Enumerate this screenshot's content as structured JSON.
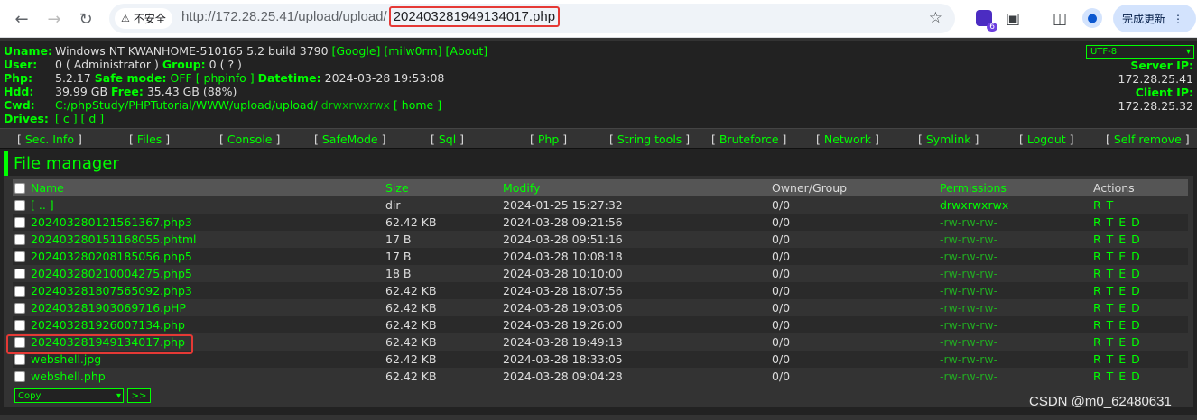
{
  "browser": {
    "security_label": "不安全",
    "url_prefix": "http://172.28.25.41/upload/upload/",
    "url_file": "202403281949134017.php",
    "update_button": "完成更新",
    "extension_badge": "6"
  },
  "info": {
    "uname_label": "Uname:",
    "uname_value": "Windows NT KWANHOME-510165 5.2 build 3790",
    "uname_links": "[Google] [milw0rm] [About]",
    "user_label": "User:",
    "user_value": "0 ( Administrator )",
    "group_label": "Group:",
    "group_value": "0 ( ? )",
    "php_label": "Php:",
    "php_value": "5.2.17",
    "safemode_label": "Safe mode:",
    "safemode_value": "OFF",
    "phpinfo_link": "[ phpinfo ]",
    "datetime_label": "Datetime:",
    "datetime_value": "2024-03-28 19:53:08",
    "hdd_label": "Hdd:",
    "hdd_value": "39.99 GB",
    "free_label": "Free:",
    "free_value": "35.43 GB (88%)",
    "cwd_label": "Cwd:",
    "cwd_value": "C:/phpStudy/PHPTutorial/WWW/upload/upload/",
    "cwd_perms": "drwxrwxrwx",
    "home_link": "[ home ]",
    "drives_label": "Drives:",
    "drives_value": "[ c ] [ d ]",
    "charset": "UTF-8",
    "server_ip_label": "Server IP:",
    "server_ip": "172.28.25.41",
    "client_ip_label": "Client IP:",
    "client_ip": "172.28.25.32"
  },
  "menu": [
    "Sec. Info",
    "Files",
    "Console",
    "SafeMode",
    "Sql",
    "Php",
    "String tools",
    "Bruteforce",
    "Network",
    "Symlink",
    "Logout",
    "Self remove"
  ],
  "file_manager": {
    "title": "File manager",
    "columns": [
      "Name",
      "Size",
      "Modify",
      "Owner/Group",
      "Permissions",
      "Actions"
    ],
    "rows": [
      {
        "name": "[ .. ]",
        "size": "dir",
        "modify": "2024-01-25 15:27:32",
        "owner": "0/0",
        "perms": "drwxrwxrwx",
        "actions": "R T"
      },
      {
        "name": "202403280121561367.php3",
        "size": "62.42 KB",
        "modify": "2024-03-28 09:21:56",
        "owner": "0/0",
        "perms": "-rw-rw-rw-",
        "actions": "R T E D"
      },
      {
        "name": "202403280151168055.phtml",
        "size": "17 B",
        "modify": "2024-03-28 09:51:16",
        "owner": "0/0",
        "perms": "-rw-rw-rw-",
        "actions": "R T E D"
      },
      {
        "name": "202403280208185056.php5",
        "size": "17 B",
        "modify": "2024-03-28 10:08:18",
        "owner": "0/0",
        "perms": "-rw-rw-rw-",
        "actions": "R T E D"
      },
      {
        "name": "202403280210004275.php5",
        "size": "18 B",
        "modify": "2024-03-28 10:10:00",
        "owner": "0/0",
        "perms": "-rw-rw-rw-",
        "actions": "R T E D"
      },
      {
        "name": "202403281807565092.php3",
        "size": "62.42 KB",
        "modify": "2024-03-28 18:07:56",
        "owner": "0/0",
        "perms": "-rw-rw-rw-",
        "actions": "R T E D"
      },
      {
        "name": "202403281903069716.pHP",
        "size": "62.42 KB",
        "modify": "2024-03-28 19:03:06",
        "owner": "0/0",
        "perms": "-rw-rw-rw-",
        "actions": "R T E D"
      },
      {
        "name": "202403281926007134.php",
        "size": "62.42 KB",
        "modify": "2024-03-28 19:26:00",
        "owner": "0/0",
        "perms": "-rw-rw-rw-",
        "actions": "R T E D"
      },
      {
        "name": "202403281949134017.php",
        "size": "62.42 KB",
        "modify": "2024-03-28 19:49:13",
        "owner": "0/0",
        "perms": "-rw-rw-rw-",
        "actions": "R T E D"
      },
      {
        "name": "webshell.jpg",
        "size": "62.42 KB",
        "modify": "2024-03-28 18:33:05",
        "owner": "0/0",
        "perms": "-rw-rw-rw-",
        "actions": "R T E D"
      },
      {
        "name": "webshell.php",
        "size": "62.42 KB",
        "modify": "2024-03-28 09:04:28",
        "owner": "0/0",
        "perms": "-rw-rw-rw-",
        "actions": "R T E D"
      }
    ],
    "bulk_action": "Copy",
    "go_button": ">>"
  },
  "watermark": "CSDN @m0_62480631",
  "colors": {
    "accent": "#00ff00",
    "highlight": "#e53935",
    "bg": "#222222"
  }
}
